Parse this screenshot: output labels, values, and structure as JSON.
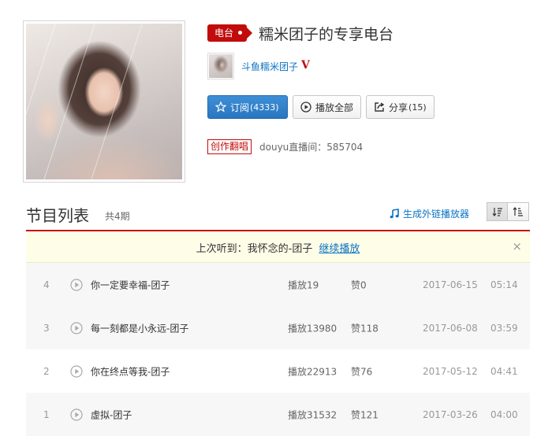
{
  "radio": {
    "badge": "电台",
    "title": "糯米团子的专享电台",
    "author": "斗鱼糯米团子",
    "vip_mark": "V"
  },
  "buttons": {
    "subscribe_label": "订阅",
    "subscribe_count": "(4333)",
    "play_all_label": "播放全部",
    "share_label": "分享",
    "share_count": "(15)"
  },
  "tag": "创作翻唱",
  "room_info": "douyu直播间：585704",
  "list": {
    "title": "节目列表",
    "count": "共4期",
    "generate_player": "生成外链播放器"
  },
  "notice": {
    "prefix": "上次听到：我怀念的-团子",
    "continue_label": "继续播放",
    "close_symbol": "×"
  },
  "tracks": [
    {
      "index": "4",
      "name": "你一定要幸福-团子",
      "plays": "播放19",
      "likes": "赞0",
      "date": "2017-06-15",
      "duration": "05:14"
    },
    {
      "index": "3",
      "name": "每一刻都是小永远-团子",
      "plays": "播放13980",
      "likes": "赞118",
      "date": "2017-06-08",
      "duration": "03:59"
    },
    {
      "index": "2",
      "name": "你在终点等我-团子",
      "plays": "播放22913",
      "likes": "赞76",
      "date": "2017-05-12",
      "duration": "04:41"
    },
    {
      "index": "1",
      "name": "虚拟-团子",
      "plays": "播放31532",
      "likes": "赞121",
      "date": "2017-03-26",
      "duration": "04:00"
    }
  ],
  "colors": {
    "accent_red": "#c20c0c",
    "link_blue": "#0c73c2",
    "primary_button": "#2a76c0",
    "notice_bg": "#fefee8"
  },
  "icons": {
    "subscribe": "star-outline-icon",
    "play_all": "play-circle-icon",
    "share": "share-icon",
    "generate_player": "music-note-icon",
    "sort_desc": "sort-descending-icon",
    "sort_asc": "sort-ascending-icon",
    "track_play": "play-circle-icon"
  }
}
